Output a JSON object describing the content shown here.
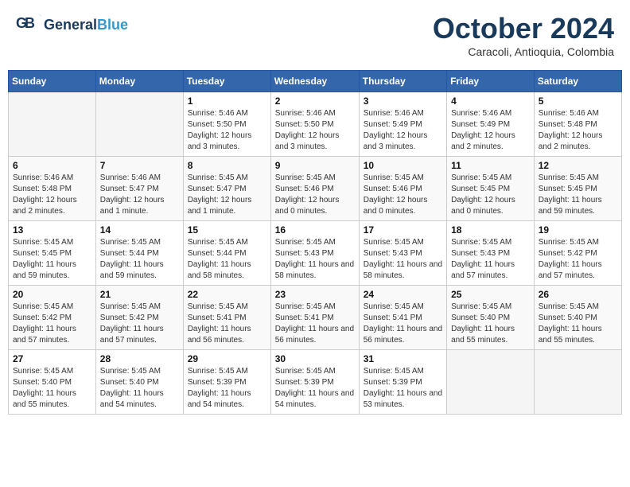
{
  "header": {
    "logo_general": "General",
    "logo_blue": "Blue",
    "month_title": "October 2024",
    "subtitle": "Caracoli, Antioquia, Colombia"
  },
  "weekdays": [
    "Sunday",
    "Monday",
    "Tuesday",
    "Wednesday",
    "Thursday",
    "Friday",
    "Saturday"
  ],
  "weeks": [
    [
      {
        "day": "",
        "info": ""
      },
      {
        "day": "",
        "info": ""
      },
      {
        "day": "1",
        "info": "Sunrise: 5:46 AM\nSunset: 5:50 PM\nDaylight: 12 hours and 3 minutes."
      },
      {
        "day": "2",
        "info": "Sunrise: 5:46 AM\nSunset: 5:50 PM\nDaylight: 12 hours and 3 minutes."
      },
      {
        "day": "3",
        "info": "Sunrise: 5:46 AM\nSunset: 5:49 PM\nDaylight: 12 hours and 3 minutes."
      },
      {
        "day": "4",
        "info": "Sunrise: 5:46 AM\nSunset: 5:49 PM\nDaylight: 12 hours and 2 minutes."
      },
      {
        "day": "5",
        "info": "Sunrise: 5:46 AM\nSunset: 5:48 PM\nDaylight: 12 hours and 2 minutes."
      }
    ],
    [
      {
        "day": "6",
        "info": "Sunrise: 5:46 AM\nSunset: 5:48 PM\nDaylight: 12 hours and 2 minutes."
      },
      {
        "day": "7",
        "info": "Sunrise: 5:46 AM\nSunset: 5:47 PM\nDaylight: 12 hours and 1 minute."
      },
      {
        "day": "8",
        "info": "Sunrise: 5:45 AM\nSunset: 5:47 PM\nDaylight: 12 hours and 1 minute."
      },
      {
        "day": "9",
        "info": "Sunrise: 5:45 AM\nSunset: 5:46 PM\nDaylight: 12 hours and 0 minutes."
      },
      {
        "day": "10",
        "info": "Sunrise: 5:45 AM\nSunset: 5:46 PM\nDaylight: 12 hours and 0 minutes."
      },
      {
        "day": "11",
        "info": "Sunrise: 5:45 AM\nSunset: 5:45 PM\nDaylight: 12 hours and 0 minutes."
      },
      {
        "day": "12",
        "info": "Sunrise: 5:45 AM\nSunset: 5:45 PM\nDaylight: 11 hours and 59 minutes."
      }
    ],
    [
      {
        "day": "13",
        "info": "Sunrise: 5:45 AM\nSunset: 5:45 PM\nDaylight: 11 hours and 59 minutes."
      },
      {
        "day": "14",
        "info": "Sunrise: 5:45 AM\nSunset: 5:44 PM\nDaylight: 11 hours and 59 minutes."
      },
      {
        "day": "15",
        "info": "Sunrise: 5:45 AM\nSunset: 5:44 PM\nDaylight: 11 hours and 58 minutes."
      },
      {
        "day": "16",
        "info": "Sunrise: 5:45 AM\nSunset: 5:43 PM\nDaylight: 11 hours and 58 minutes."
      },
      {
        "day": "17",
        "info": "Sunrise: 5:45 AM\nSunset: 5:43 PM\nDaylight: 11 hours and 58 minutes."
      },
      {
        "day": "18",
        "info": "Sunrise: 5:45 AM\nSunset: 5:43 PM\nDaylight: 11 hours and 57 minutes."
      },
      {
        "day": "19",
        "info": "Sunrise: 5:45 AM\nSunset: 5:42 PM\nDaylight: 11 hours and 57 minutes."
      }
    ],
    [
      {
        "day": "20",
        "info": "Sunrise: 5:45 AM\nSunset: 5:42 PM\nDaylight: 11 hours and 57 minutes."
      },
      {
        "day": "21",
        "info": "Sunrise: 5:45 AM\nSunset: 5:42 PM\nDaylight: 11 hours and 57 minutes."
      },
      {
        "day": "22",
        "info": "Sunrise: 5:45 AM\nSunset: 5:41 PM\nDaylight: 11 hours and 56 minutes."
      },
      {
        "day": "23",
        "info": "Sunrise: 5:45 AM\nSunset: 5:41 PM\nDaylight: 11 hours and 56 minutes."
      },
      {
        "day": "24",
        "info": "Sunrise: 5:45 AM\nSunset: 5:41 PM\nDaylight: 11 hours and 56 minutes."
      },
      {
        "day": "25",
        "info": "Sunrise: 5:45 AM\nSunset: 5:40 PM\nDaylight: 11 hours and 55 minutes."
      },
      {
        "day": "26",
        "info": "Sunrise: 5:45 AM\nSunset: 5:40 PM\nDaylight: 11 hours and 55 minutes."
      }
    ],
    [
      {
        "day": "27",
        "info": "Sunrise: 5:45 AM\nSunset: 5:40 PM\nDaylight: 11 hours and 55 minutes."
      },
      {
        "day": "28",
        "info": "Sunrise: 5:45 AM\nSunset: 5:40 PM\nDaylight: 11 hours and 54 minutes."
      },
      {
        "day": "29",
        "info": "Sunrise: 5:45 AM\nSunset: 5:39 PM\nDaylight: 11 hours and 54 minutes."
      },
      {
        "day": "30",
        "info": "Sunrise: 5:45 AM\nSunset: 5:39 PM\nDaylight: 11 hours and 54 minutes."
      },
      {
        "day": "31",
        "info": "Sunrise: 5:45 AM\nSunset: 5:39 PM\nDaylight: 11 hours and 53 minutes."
      },
      {
        "day": "",
        "info": ""
      },
      {
        "day": "",
        "info": ""
      }
    ]
  ]
}
